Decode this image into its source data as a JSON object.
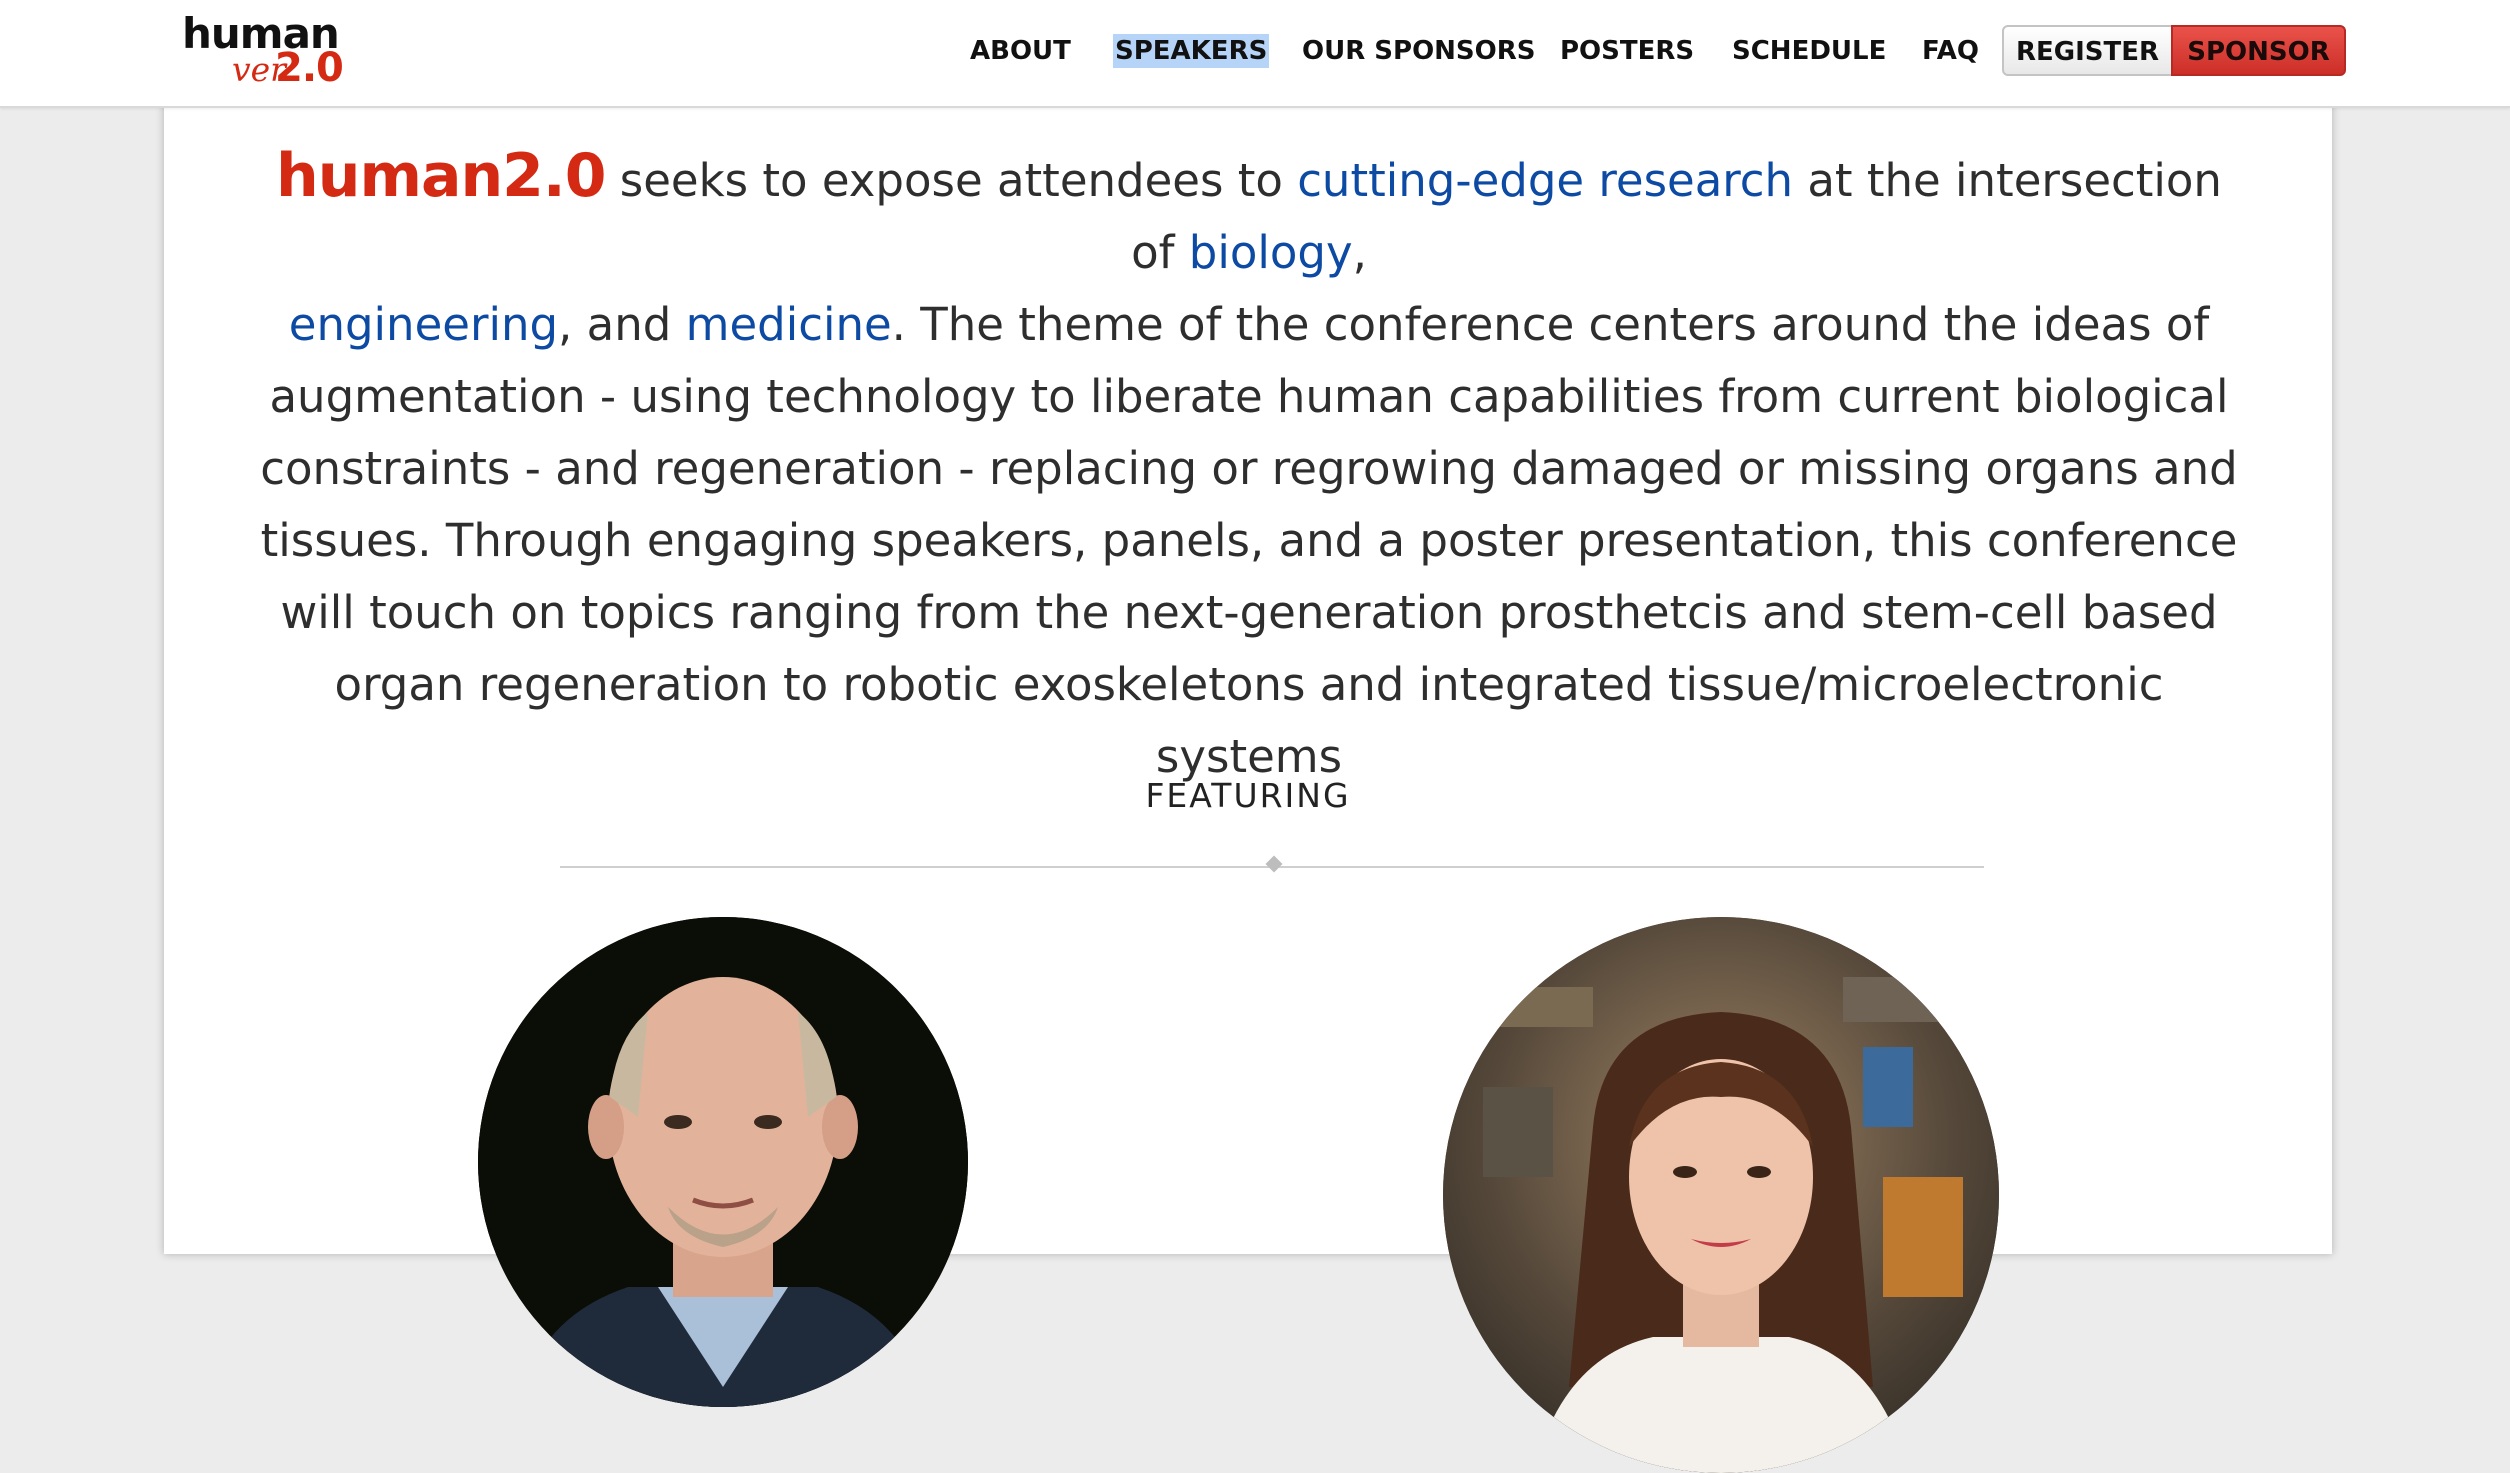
{
  "header": {
    "logo": {
      "word": "human",
      "ver": "ver",
      "num": "2.0"
    },
    "nav": [
      {
        "label": "ABOUT"
      },
      {
        "label": "SPEAKERS"
      },
      {
        "label": "OUR SPONSORS"
      },
      {
        "label": "POSTERS"
      },
      {
        "label": "SCHEDULE"
      },
      {
        "label": "FAQ"
      }
    ],
    "register_label": "REGISTER",
    "sponsor_label": "SPONSOR"
  },
  "intro": {
    "brand": "human2.0",
    "t1": " seeks to expose attendees to ",
    "link1": "cutting-edge research",
    "t2": " at the intersection of ",
    "link2": "biology",
    "t3": ", ",
    "link3": "engineering",
    "t4": ", and ",
    "link4": "medicine",
    "t5": ". The theme of the conference centers around the ideas of augmentation - using technology to liberate human capabilities from current biological constraints - and regeneration - replacing or regrowing damaged or missing organs and tissues. Through engaging speakers, panels, and a poster presentation, this conference will touch on topics ranging from the next-generation prosthetcis and stem-cell based organ regeneration to robotic exoskeletons and integrated tissue/microelectronic systems"
  },
  "featuring": {
    "heading": "FEATURING"
  },
  "colors": {
    "brand_red": "#d42a14",
    "link_blue": "#0d4aa3",
    "active_highlight": "#b5d4f7"
  }
}
